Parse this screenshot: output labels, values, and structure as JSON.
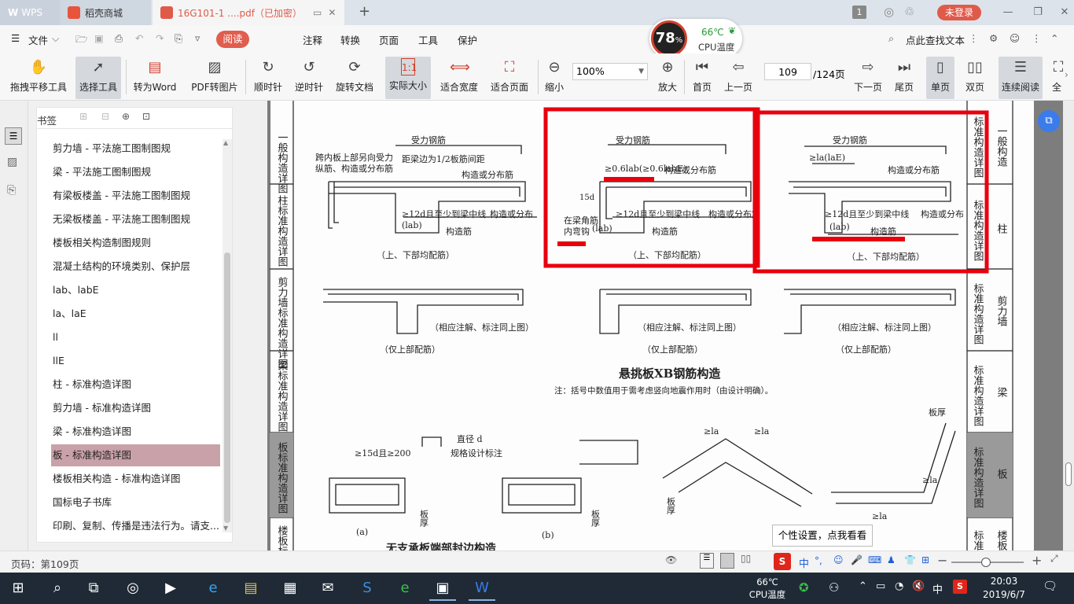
{
  "titlebar": {
    "tabs": [
      {
        "label": "WPS"
      },
      {
        "label": "稻壳商城"
      },
      {
        "label": "16G101-1 ....pdf（已加密）"
      }
    ],
    "badge": "1",
    "login": "未登录"
  },
  "menu": {
    "file": "文件",
    "items": [
      "阅读",
      "注释",
      "转换",
      "页面",
      "工具",
      "保护"
    ],
    "search": "点此查找文本"
  },
  "cpu": {
    "percent": "78",
    "unit": "%",
    "temp": "66℃",
    "label": "CPU温度"
  },
  "toolbar": {
    "hand": "拖拽平移工具",
    "select": "选择工具",
    "toword": "转为Word",
    "toimg": "PDF转图片",
    "cw": "顺时针",
    "ccw": "逆时针",
    "rotate": "旋转文档",
    "actual": "实际大小",
    "fitwidth": "适合宽度",
    "fitpage": "适合页面",
    "zoomout": "缩小",
    "zoom": "100%",
    "zoomin": "放大",
    "first": "首页",
    "prev": "上一页",
    "page": "109",
    "total": "/124页",
    "next": "下一页",
    "last": "尾页",
    "single": "单页",
    "double": "双页",
    "continuous": "连续阅读",
    "fullscreen": "全"
  },
  "sidebar": {
    "title": "书签",
    "items": [
      "剪力墙 - 平法施工图制图规",
      "梁 - 平法施工图制图规",
      "有梁板楼盖 - 平法施工图制图规",
      "无梁板楼盖 - 平法施工图制图规",
      "楼板相关构造制图规则",
      "混凝土结构的环境类别、保护层",
      "lab、labE",
      "la、laE",
      "ll",
      "llE",
      "柱 - 标准构造详图",
      "剪力墙 - 标准构造详图",
      "梁 - 标准构造详图",
      "板 - 标准构造详图",
      "楼板相关构造 - 标准构造详图",
      "国标电子书库",
      "印刷、复制、传播是违法行为。请支..."
    ],
    "active_index": 13
  },
  "document": {
    "left_tabs": [
      "一般构造详图",
      "柱标准构造详图",
      "剪力墙标准构造详图",
      "梁标准构造详图",
      "板标准构造详图",
      "楼板标准构造"
    ],
    "right_tabs": [
      {
        "a": "标准构造详图",
        "b": "一般构造"
      },
      {
        "a": "标准构造详图",
        "b": "柱"
      },
      {
        "a": "标准构造详图",
        "b": "剪力墙"
      },
      {
        "a": "标准构造详图",
        "b": "梁"
      },
      {
        "a": "标准构造详图",
        "b": "板"
      },
      {
        "a": "标准",
        "b": "楼板"
      }
    ],
    "labels": {
      "shouli": "受力钢筋",
      "kuanei": "跨内板上部另向受力",
      "kuanei2": "纵筋、构造或分布筋",
      "juliang": "距梁边为1/2板筋间距",
      "gouzao": "构造或分布筋",
      "gouzao_fen": "构造或分布",
      "twelve_d": "≥12d且至少到梁中线",
      "lab": "(lab)",
      "gouzaojin": "构造筋",
      "shangxia": "（上、下部均配筋）",
      "zai_liang": "在梁角筋",
      "nei_wangou": "内弯钩",
      "fifteen_d": "15d",
      "la_formula": "≥0.6lab(≥0.6labE)",
      "la_ge": "≥la(laE)",
      "xiangying": "（相应注解、标注同上图）",
      "jinshang": "（仅上部配筋）",
      "title": "悬挑板XB钢筋构造",
      "note": "注：括号中数值用于需考虑竖向地震作用时（由设计明确）。",
      "zhijing": "直径 d",
      "guige": "规格设计标注",
      "fifteen_200": "≥15d且≥200",
      "banhou": "板厚",
      "a": "(a)",
      "b": "(b)",
      "la": "≥la",
      "bottom_title": "无支承板端部封边构造"
    }
  },
  "tooltip": "个性设置，点我看看",
  "status": {
    "page": "页码：第109页"
  },
  "ime": {
    "lang": "中",
    "punct": "°,"
  },
  "taskbar": {
    "temp": "66℃",
    "temp_label": "CPU温度",
    "lang": "中",
    "time": "20:03",
    "date": "2019/6/7"
  },
  "colors": {
    "accent": "#e15d4e",
    "highlight_red": "#e8000e",
    "active_bookmark": "#c9a1a8",
    "taskbar": "#1f2a36"
  }
}
